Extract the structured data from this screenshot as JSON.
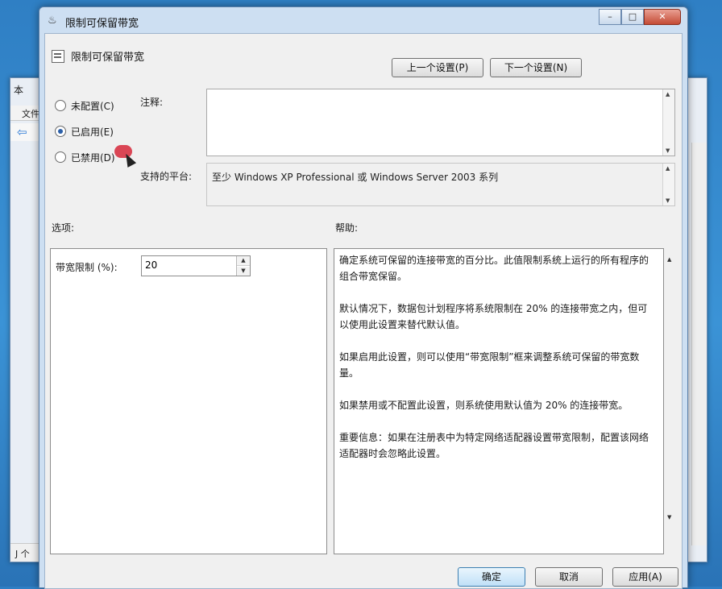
{
  "background_window": {
    "title": "本",
    "menu": "文件",
    "status": "J 个"
  },
  "dialog": {
    "title": "限制可保留带宽",
    "header_title": "限制可保留带宽",
    "prev_button": "上一个设置(P)",
    "next_button": "下一个设置(N)",
    "radio_not_configured": "未配置(C)",
    "radio_enabled": "已启用(E)",
    "radio_disabled": "已禁用(D)",
    "comment_label": "注释:",
    "comment_value": "",
    "platform_label": "支持的平台:",
    "platform_value": "至少 Windows XP Professional 或 Windows Server 2003 系列",
    "options_label": "选项:",
    "help_label": "帮助:",
    "bandwidth_label": "带宽限制 (%):",
    "bandwidth_value": "20",
    "help_text": "确定系统可保留的连接带宽的百分比。此值限制系统上运行的所有程序的组合带宽保留。\n\n默认情况下，数据包计划程序将系统限制在 20% 的连接带宽之内，但可以使用此设置来替代默认值。\n\n如果启用此设置，则可以使用“带宽限制”框来调整系统可保留的带宽数量。\n\n如果禁用或不配置此设置，则系统使用默认值为 20% 的连接带宽。\n\n重要信息：如果在注册表中为特定网络适配器设置带宽限制，配置该网络适配器时会忽略此设置。",
    "ok_button": "确定",
    "cancel_button": "取消",
    "apply_button": "应用(A)"
  }
}
